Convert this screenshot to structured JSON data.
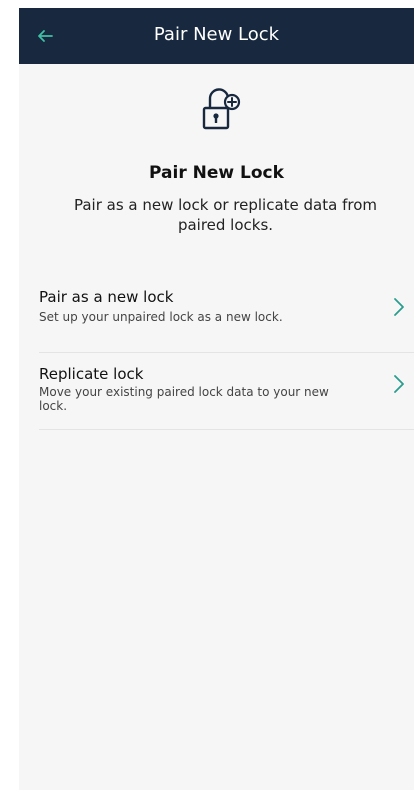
{
  "header": {
    "title": "Pair New Lock",
    "back_icon": "back-arrow-icon",
    "background_color": "#17283f",
    "back_icon_color": "#3fbfa5"
  },
  "intro": {
    "icon": "lock-add-icon",
    "title": "Pair New Lock",
    "subtitle": "Pair as a new lock or replicate data from paired locks."
  },
  "options": [
    {
      "title": "Pair as a new lock",
      "description": "Set up your unpaired lock as a new lock.",
      "icon": "chevron-right-icon"
    },
    {
      "title": "Replicate lock",
      "description": "Move your existing paired lock data to your new lock.",
      "icon": "chevron-right-icon"
    }
  ],
  "accent_color": "#2a9d8f"
}
